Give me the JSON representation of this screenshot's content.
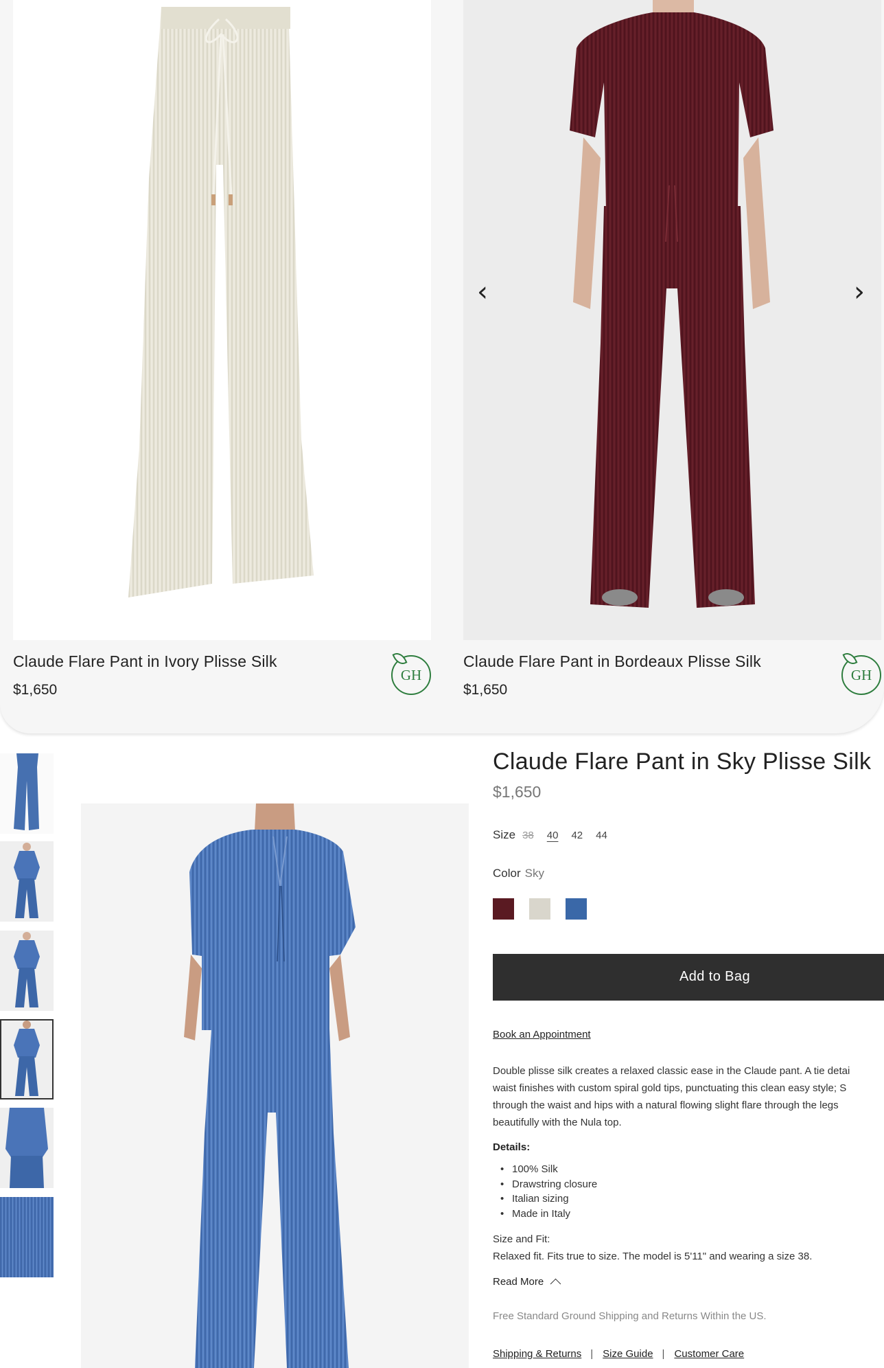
{
  "tiles": [
    {
      "name": "Claude Flare Pant in Ivory Plisse Silk",
      "price": "$1,650",
      "badge": "GH",
      "image": "ivory-pants-image"
    },
    {
      "name": "Claude Flare Pant in Bordeaux Plisse Silk",
      "price": "$1,650",
      "badge": "GH",
      "image": "bordeaux-outfit-image"
    }
  ],
  "carousel": {
    "prev_icon": "‹",
    "next_icon": "›"
  },
  "product": {
    "title": "Claude Flare Pant in Sky Plisse Silk",
    "price": "$1,650",
    "size_label": "Size",
    "sizes": [
      {
        "label": "38",
        "state": "unavailable"
      },
      {
        "label": "40",
        "state": "selected"
      },
      {
        "label": "42",
        "state": "available"
      },
      {
        "label": "44",
        "state": "available"
      }
    ],
    "color_label": "Color",
    "color_value": "Sky",
    "swatches": [
      {
        "name": "Bordeaux",
        "color": "#5a1a22"
      },
      {
        "name": "Ivory",
        "color": "#d9d6cc"
      },
      {
        "name": "Sky",
        "color": "#3a68a8"
      }
    ],
    "add_to_bag": "Add to Bag",
    "book_appointment": "Book an Appointment",
    "description_lines": [
      "Double plisse silk creates a relaxed classic ease in the Claude pant. A tie detai",
      "waist finishes with custom spiral gold tips, punctuating this clean easy style; S",
      "through the waist and hips with a natural flowing slight flare through the legs",
      "beautifully with the Nula top."
    ],
    "details_heading": "Details:",
    "details": [
      "100% Silk",
      "Drawstring closure",
      "Italian sizing",
      "Made in Italy"
    ],
    "fit_heading": "Size and Fit:",
    "fit_text": "Relaxed fit. Fits true to size. The model is 5'11\" and wearing a size 38.",
    "read_more": "Read More",
    "shipping_note": "Free Standard Ground Shipping and Returns Within the US.",
    "links": [
      "Shipping & Returns",
      "Size Guide",
      "Customer Care"
    ]
  },
  "colors": {
    "button_dark": "#2f2f2f",
    "badge_green": "#2e7d3e",
    "sky": "#4a74b8",
    "bordeaux": "#5a1a22",
    "ivory": "#e9e6da"
  }
}
